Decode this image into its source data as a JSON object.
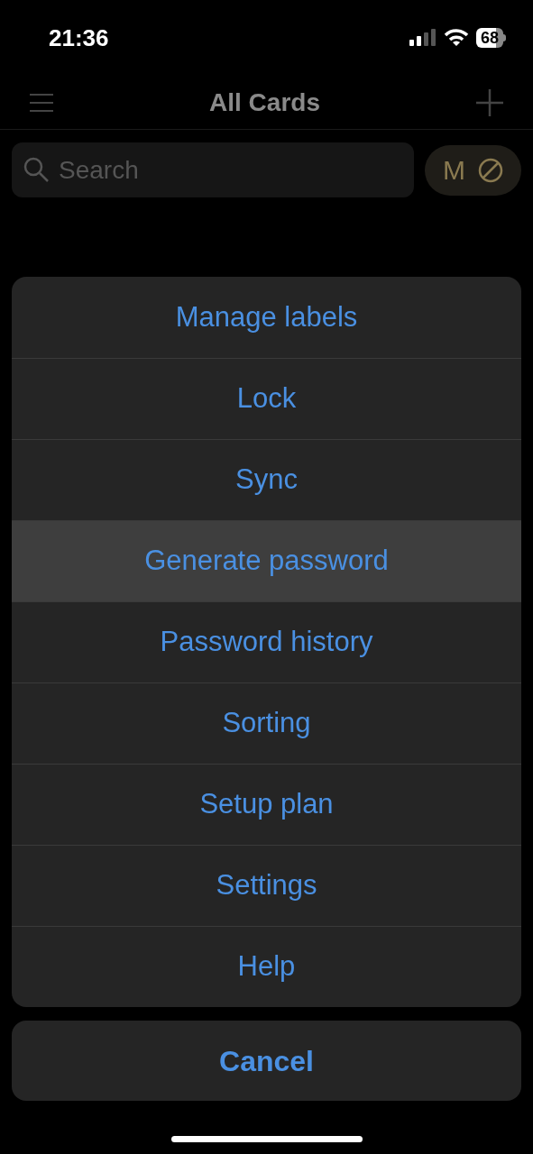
{
  "status_bar": {
    "time": "21:36",
    "battery": "68"
  },
  "nav": {
    "title": "All Cards"
  },
  "search": {
    "placeholder": "Search"
  },
  "filter_chip": {
    "label": "M"
  },
  "action_sheet": {
    "items": [
      {
        "label": "Manage labels",
        "selected": false
      },
      {
        "label": "Lock",
        "selected": false
      },
      {
        "label": "Sync",
        "selected": false
      },
      {
        "label": "Generate password",
        "selected": true
      },
      {
        "label": "Password history",
        "selected": false
      },
      {
        "label": "Sorting",
        "selected": false
      },
      {
        "label": "Setup plan",
        "selected": false
      },
      {
        "label": "Settings",
        "selected": false
      },
      {
        "label": "Help",
        "selected": false
      }
    ],
    "cancel": "Cancel"
  }
}
